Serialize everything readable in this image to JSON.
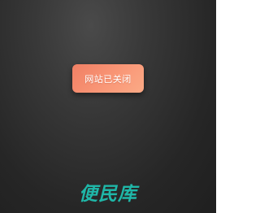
{
  "notice": {
    "message": "网站已关闭",
    "background_color": "#f99777",
    "text_color": "#ffffff"
  },
  "brand": {
    "logo_text": "便民库",
    "color": "#1fb7a8"
  },
  "page": {
    "background_color": "#2e2e2e"
  }
}
